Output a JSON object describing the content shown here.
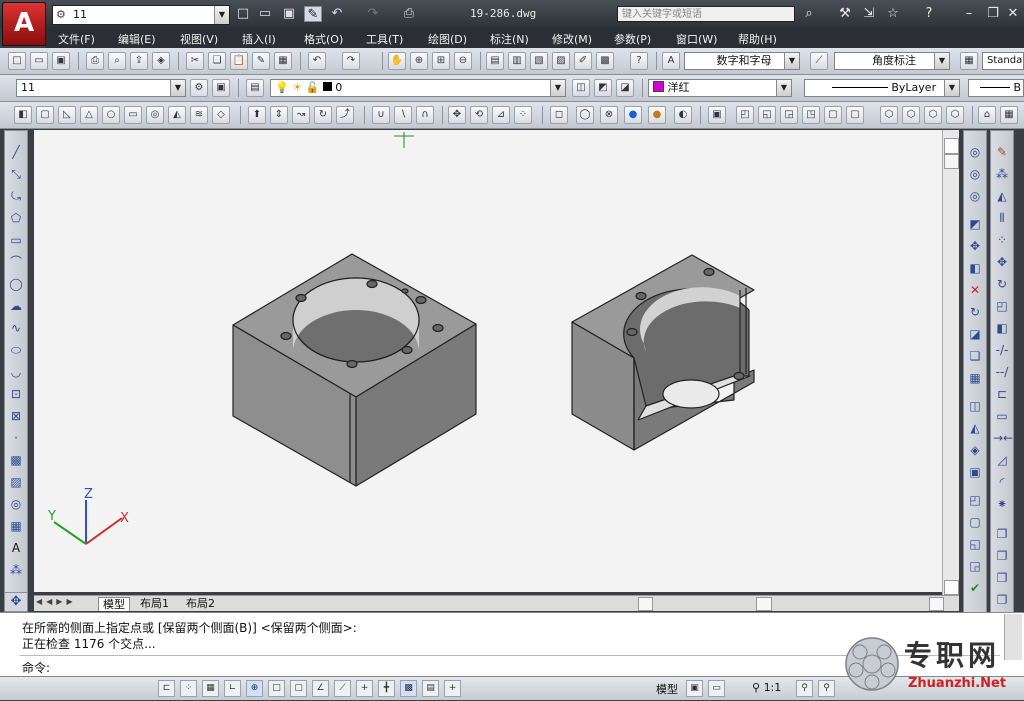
{
  "app": {
    "logo_letter": "A",
    "doc_title": "19-286.dwg"
  },
  "quick_access": {
    "workspace_value": "11",
    "search_placeholder": "键入关键字或短语"
  },
  "menu": [
    "文件(F)",
    "编辑(E)",
    "视图(V)",
    "插入(I)",
    "格式(O)",
    "工具(T)",
    "绘图(D)",
    "标注(N)",
    "修改(M)",
    "参数(P)",
    "窗口(W)",
    "帮助(H)"
  ],
  "styles_toolbar": {
    "text_style": "数字和字母",
    "dim_style": "角度标注",
    "table_style": "Standa"
  },
  "layers_toolbar": {
    "layer_state": "11",
    "current_layer": "0"
  },
  "properties_toolbar": {
    "color": "洋红",
    "color_swatch": "#d000d0",
    "linetype": "ByLayer",
    "lineweight": "B"
  },
  "layout_tabs": [
    "模型",
    "布局1",
    "布局2"
  ],
  "command": {
    "history": [
      "在所需的侧面上指定点或 [保留两个侧面(B)] <保留两个侧面>:",
      "正在检查 1176 个交点..."
    ],
    "prompt": "命令:"
  },
  "status": {
    "model_label": "模型",
    "annotation_scale": "1:1"
  },
  "ucs": {
    "x": "X",
    "y": "Y",
    "z": "Z"
  },
  "watermark": {
    "text": "专职网",
    "url": "Zhuanzhi.Net"
  },
  "icons": [
    "gear-icon",
    "new-file-icon",
    "open-icon",
    "save-icon",
    "save-as-icon",
    "undo-icon",
    "redo-icon",
    "print-icon",
    "binoculars-icon",
    "wrench-icon",
    "star-icon",
    "help-icon",
    "minimize-icon",
    "restore-icon",
    "close-icon"
  ]
}
